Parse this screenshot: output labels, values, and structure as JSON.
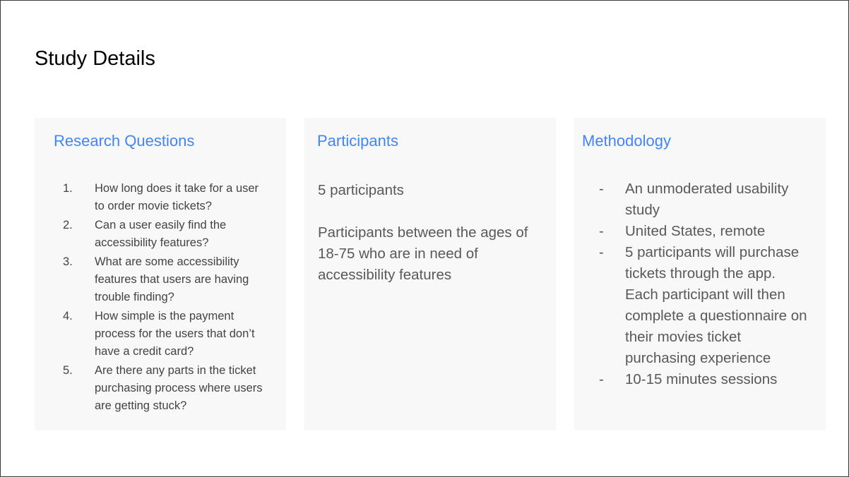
{
  "slide": {
    "title": "Study Details"
  },
  "panels": {
    "research": {
      "heading": "Research Questions",
      "items": [
        {
          "num": "1.",
          "text": "How long does it take for a user to order movie tickets?"
        },
        {
          "num": "2.",
          "text": "Can a user easily find the accessibility features?"
        },
        {
          "num": "3.",
          "text": "What are some accessibility features that users are having trouble finding?"
        },
        {
          "num": "4.",
          "text": "How simple is the payment process for the users that don’t have a credit card?"
        },
        {
          "num": "5.",
          "text": "Are there any parts in the ticket purchasing process where users are getting stuck?"
        }
      ]
    },
    "participants": {
      "heading": "Participants",
      "count_text": "5 participants",
      "description": "Participants between the ages of 18-75 who are in need of accessibility features"
    },
    "methodology": {
      "heading": "Methodology",
      "bullet": "-",
      "items": [
        "An unmoderated usability study",
        "United States, remote",
        "5 participants will purchase tickets through the app. Each participant will then complete a questionnaire on their movies ticket purchasing experience",
        "10-15 minutes sessions"
      ]
    }
  },
  "colors": {
    "heading_accent": "#4285f4",
    "body_text": "#595959",
    "panel_bg": "#f8f8f8"
  }
}
